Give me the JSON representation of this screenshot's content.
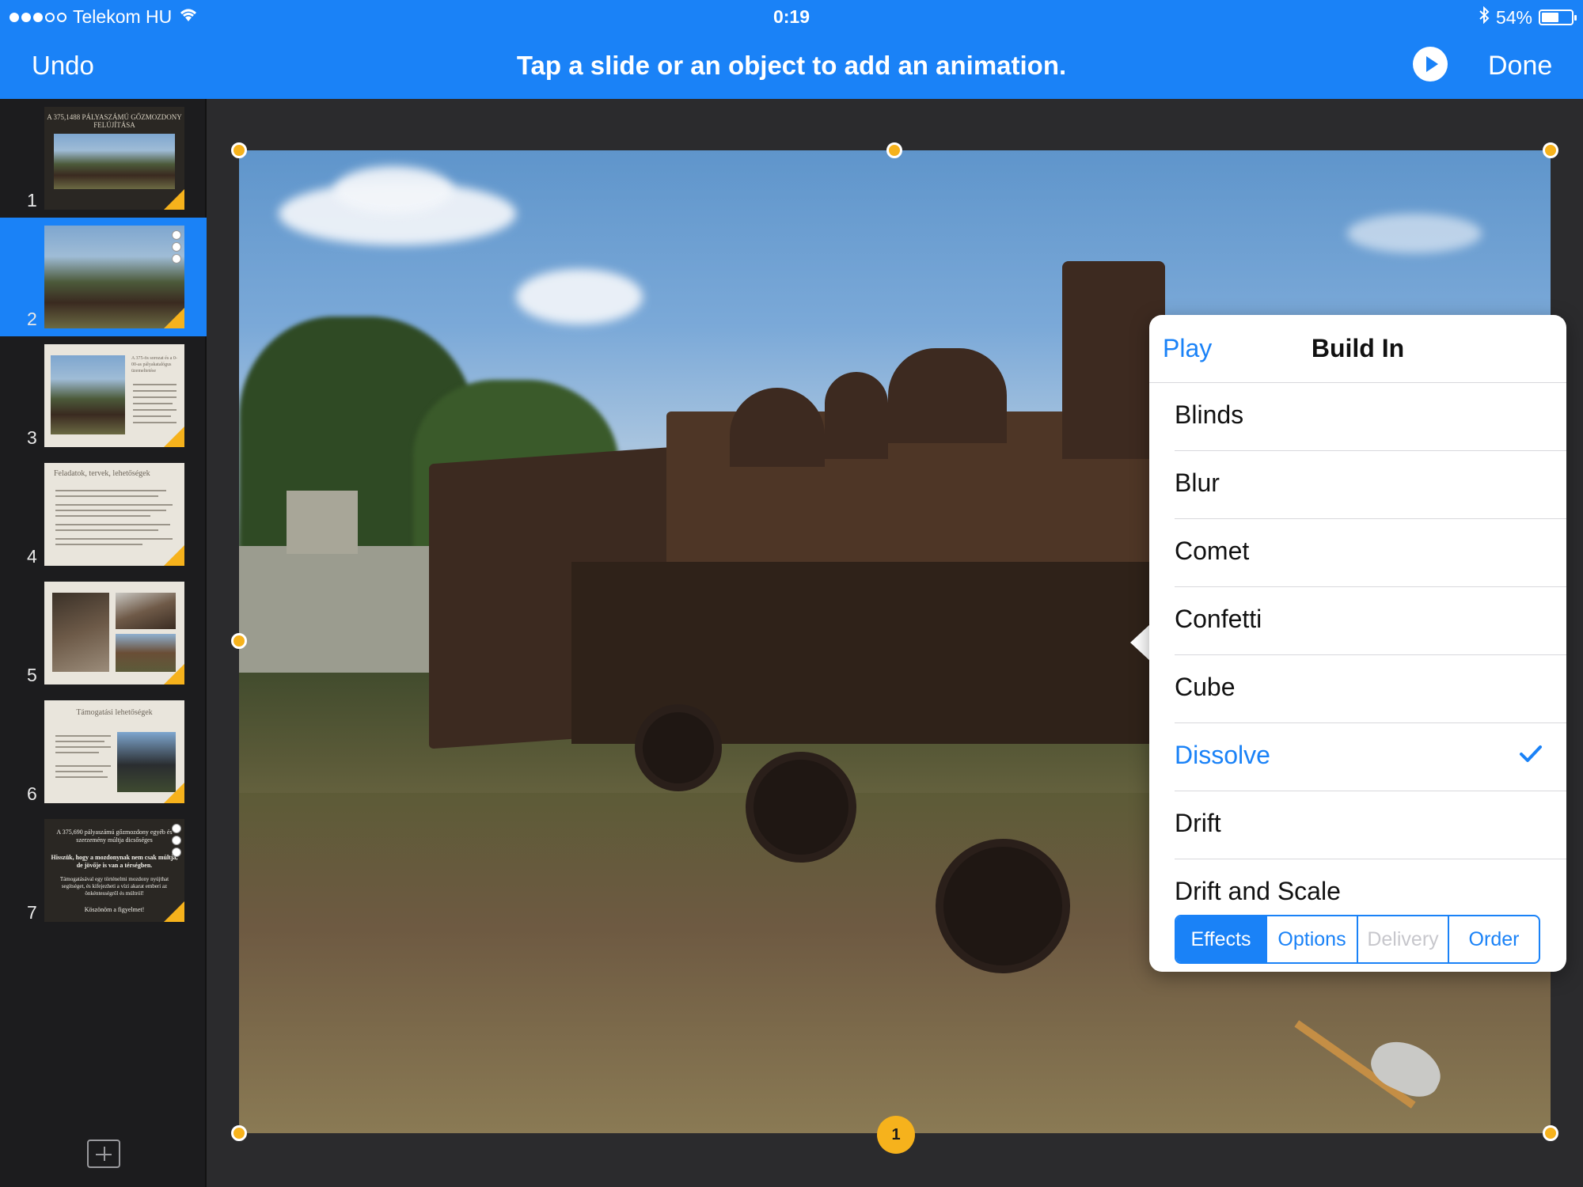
{
  "status": {
    "carrier": "Telekom HU",
    "time": "0:19",
    "battery": "54%"
  },
  "nav": {
    "undo": "Undo",
    "title": "Tap a slide or an object to add an animation.",
    "done": "Done"
  },
  "slides": [
    {
      "number": "1",
      "title": "A 375,1488 PÁLYASZÁMÚ GŐZMOZDONY FELÚJÍTÁSA"
    },
    {
      "number": "2"
    },
    {
      "number": "3",
      "title": "A 375-ös sorozat és a 0-00-as pályakatalógus üzemeltetése"
    },
    {
      "number": "4",
      "title": "Feladatok, tervek, lehetőségek"
    },
    {
      "number": "5"
    },
    {
      "number": "6",
      "title": "Támogatási lehetőségek"
    },
    {
      "number": "7",
      "lines": [
        "A 375,690 pályaszámú gőzmozdony egyéb és szerzemény múltja dicsőséges",
        "Hisszük, hogy a mozdonynak nem csak múltja, de jövője is van a térségben.",
        "Támogatásával egy történelmi mozdony nyújthat segítséget, és kifejezheti a vízi akarat emberi az önkéntességről és múltról!",
        "Köszönöm a figyelmet!"
      ]
    }
  ],
  "build_badge": "1",
  "popover": {
    "play": "Play",
    "title": "Build In",
    "effects": [
      {
        "label": "Blinds",
        "selected": false
      },
      {
        "label": "Blur",
        "selected": false
      },
      {
        "label": "Comet",
        "selected": false
      },
      {
        "label": "Confetti",
        "selected": false
      },
      {
        "label": "Cube",
        "selected": false
      },
      {
        "label": "Dissolve",
        "selected": true
      },
      {
        "label": "Drift",
        "selected": false
      },
      {
        "label": "Drift and Scale",
        "selected": false
      }
    ],
    "tabs": [
      {
        "label": "Effects",
        "state": "active"
      },
      {
        "label": "Options",
        "state": "normal"
      },
      {
        "label": "Delivery",
        "state": "disabled"
      },
      {
        "label": "Order",
        "state": "normal"
      }
    ]
  },
  "colors": {
    "accent": "#1a82f7",
    "build_marker": "#f6b21c",
    "sidebar_bg": "#1c1c1e",
    "canvas_bg": "#2b2b2d"
  }
}
